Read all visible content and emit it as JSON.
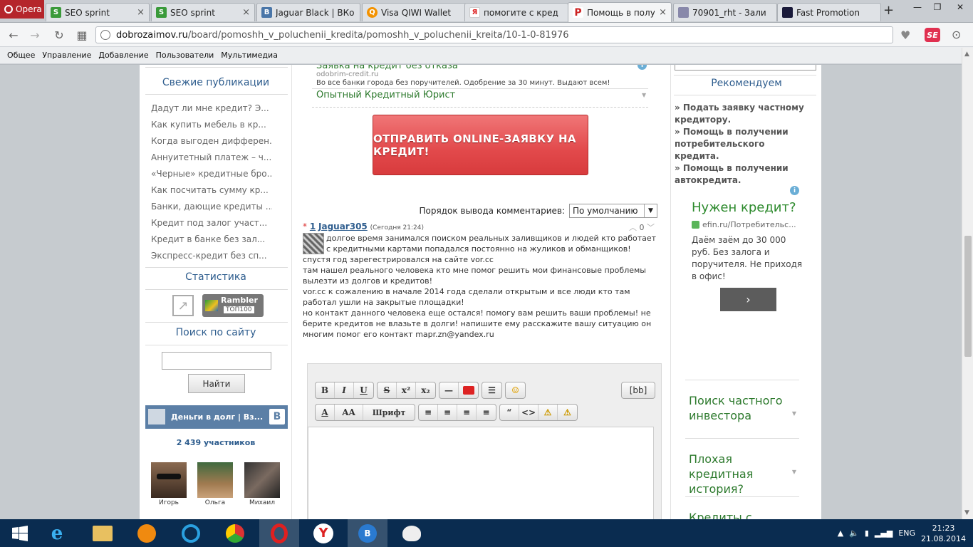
{
  "browser": {
    "opera_label": "Opera",
    "tabs": [
      {
        "title": "SEO sprint",
        "icon": "seosprint-icon"
      },
      {
        "title": "SEO sprint",
        "icon": "seosprint-icon"
      },
      {
        "title": "Jaguar Black | ВКо",
        "icon": "vk-icon"
      },
      {
        "title": "Visa QIWI Wallet",
        "icon": "qiwi-icon"
      },
      {
        "title": "помогите с кред",
        "icon": "yandex-icon"
      },
      {
        "title": "Помощь в получ",
        "icon": "site-icon"
      },
      {
        "title": "70901_rht - Зали",
        "icon": "image-icon"
      },
      {
        "title": "Fast Promotion",
        "icon": "fastpromo-icon"
      }
    ],
    "new_tab": "+",
    "url_domain": "dobrozaimov.ru",
    "url_path": "/board/pomoshh_v_poluchenii_kredita/pomoshh_v_poluchenii_kreita/10-1-0-81976",
    "se_label": "SE",
    "bookmarks": [
      "Общее",
      "Управление",
      "Добавление",
      "Пользователи",
      "Мультимедиа"
    ]
  },
  "left": {
    "fresh_title": "Свежие публикации",
    "publications": [
      "Дадут ли мне кредит? Э...",
      "Как купить мебель в кр...",
      "Когда выгоден дифферен...",
      "Аннуитетный платеж – ч...",
      "«Черные» кредитные бро...",
      "Как посчитать сумму кр...",
      "Банки, дающие кредиты ...",
      "Кредит под залог участ...",
      "Кредит в банке без зал...",
      "Экспресс-кредит без сп..."
    ],
    "stats_title": "Статистика",
    "rambler_top": "Rambler",
    "rambler_sub": "ТОП100",
    "search_title": "Поиск по сайту",
    "search_value": "",
    "search_button": "Найти",
    "vk_group": "Деньги в долг | Вз...",
    "vk_logo": "В",
    "members": "2 439 участников",
    "people": [
      "Игорь",
      "Ольга",
      "Михаил"
    ]
  },
  "center": {
    "ad_line1": "Заявка на кредит без отказа",
    "ad_domain": "odobrim-credit.ru",
    "ad_desc": "Во все банки города без поручителей. Одобрение за 30 минут. Выдают всем!",
    "ad_line2": "Опытный Кредитный Юрист",
    "cta": "ОТПРАВИТЬ ONLINE-ЗАЯВКУ НА КРЕДИТ!",
    "sort_label": "Порядок вывода комментариев:",
    "sort_value": "По умолчанию",
    "comment": {
      "star": "*",
      "num": "1",
      "author": "Jaguar305",
      "date": "(Сегодня 21:24)",
      "votes": "0",
      "lines": [
        "долгое время занимался поиском реальных заливщиков и людей кто работает с кредитными картами попадался постоянно на жуликов и обманщиков! спустя год зарегестрировался на сайте vor.cc",
        "там нашел реального человека кто мне помог решить мои финансовые проблемы вылезти из долгов и кредитов!",
        "vor.cc к сожалению в начале 2014 года сделали открытым и все люди кто там работал ушли на закрытые площадки!",
        "но контакт данного человека еще остался! помогу вам решить ваши проблемы! не берите кредитов не влазьте в долги! напишите ему расскажите вашу ситуацию он многим помог его контакт mapr.zn@yandex.ru"
      ]
    },
    "editor": {
      "bb_label": "[bb]",
      "font_label": "Шрифт",
      "size_label": "AA"
    }
  },
  "right": {
    "rec_title": "Рекомендуем",
    "rec_items": [
      "» Подать заявку частному кредитору.",
      "» Помощь в получении потребительского кредита.",
      "» Помощь в получении автокредита."
    ],
    "ad_title": "Нужен кредит?",
    "ad_domain": "efin.ru/Потребительс...",
    "ad_text": "Даём заём до 30 000 руб. Без залога и поручителя. Не приходя в офис!",
    "ad_btn": "›",
    "boxes": [
      "Поиск частного инвестора",
      "Плохая кредитная история?",
      "Кредиты с"
    ]
  },
  "taskbar": {
    "lang": "ENG",
    "time": "21:23",
    "date": "21.08.2014"
  }
}
